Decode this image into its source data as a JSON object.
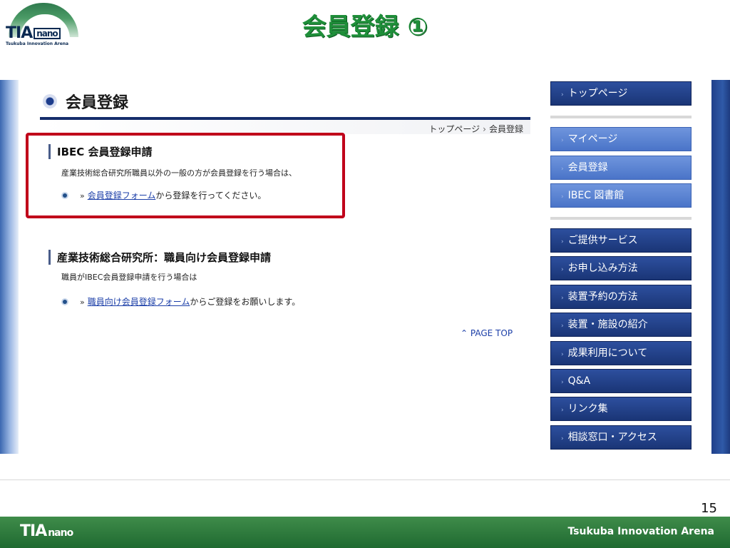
{
  "slide": {
    "title": "会員登録 ①",
    "page_number": "15",
    "logo_text": "TIA",
    "logo_nano": "nano",
    "logo_subtitle": "Tsukuba Innovation Arena",
    "footer_logo_text": "TIA",
    "footer_logo_nano": "nano",
    "footer_brand": "Tsukuba Innovation Arena",
    "colors": {
      "title_green": "#1f8f3a",
      "footer_green": "#2f7a3d",
      "highlight_red": "#c0001a",
      "nav_navy": "#1f3d86"
    }
  },
  "web": {
    "page_title": "会員登録",
    "breadcrumb": {
      "home": "トップページ",
      "separator": "›",
      "current": "会員登録"
    },
    "sections": [
      {
        "title": "IBEC 会員登録申請",
        "description": "産業技術総合研究所職員以外の一般の方が会員登録を行う場合は、",
        "link_text": "会員登録フォーム",
        "link_suffix": "から登録を行ってください。"
      },
      {
        "title": "産業技術総合研究所：職員向け会員登録申請",
        "description": "職員がIBEC会員登録申請を行う場合は",
        "link_text": "職員向け会員登録フォーム",
        "link_suffix": "からご登録をお願いします。"
      }
    ],
    "page_top_label": "PAGE TOP",
    "link_marker": "»",
    "nav": {
      "group1": [
        {
          "label": "トップページ"
        }
      ],
      "group2": [
        {
          "label": "マイページ"
        },
        {
          "label": "会員登録"
        },
        {
          "label": "IBEC 図書館"
        }
      ],
      "group3": [
        {
          "label": "ご提供サービス"
        },
        {
          "label": "お申し込み方法"
        },
        {
          "label": "装置予約の方法"
        },
        {
          "label": "装置・施設の紹介"
        },
        {
          "label": "成果利用について"
        },
        {
          "label": "Q&A"
        },
        {
          "label": "リンク集"
        },
        {
          "label": "相談窓口・アクセス"
        }
      ]
    }
  }
}
